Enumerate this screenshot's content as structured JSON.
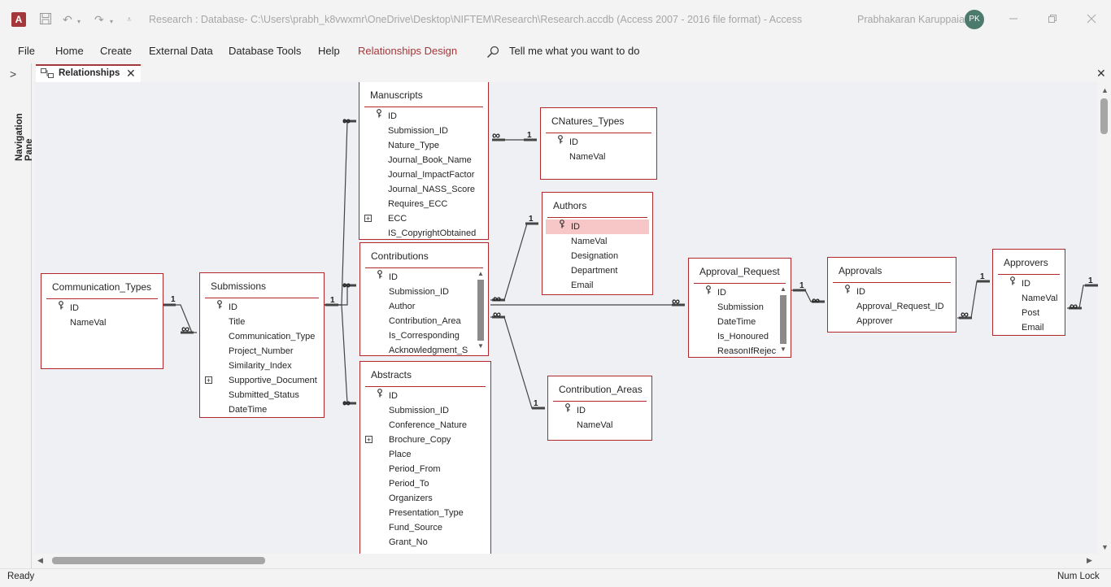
{
  "titlebar": {
    "app_letter": "A",
    "title": "Research : Database- C:\\Users\\prabh_k8vwxmr\\OneDrive\\Desktop\\NIFTEM\\Research\\Research.accdb (Access 2007 - 2016 file format)  -  Access",
    "user": "Prabhakaran Karuppaiah",
    "initials": "PK"
  },
  "menu": [
    "File",
    "Home",
    "Create",
    "External Data",
    "Database Tools",
    "Help",
    "Relationships Design"
  ],
  "search": {
    "text": "Tell me what you want to do"
  },
  "nav": {
    "label": "Navigation Pane"
  },
  "tab": {
    "label": "Relationships"
  },
  "tables": [
    {
      "id": "communication-types",
      "title": "Communication_Types",
      "fields": [
        "ID",
        "NameVal"
      ],
      "keys": [
        0
      ]
    },
    {
      "id": "submissions",
      "title": "Submissions",
      "fields": [
        "ID",
        "Title",
        "Communication_Type",
        "Project_Number",
        "Similarity_Index",
        "Supportive_Document",
        "Submitted_Status",
        "DateTime"
      ],
      "keys": [
        0
      ],
      "plus": [
        5
      ]
    },
    {
      "id": "manuscripts",
      "title": "Manuscripts",
      "fields": [
        "ID",
        "Submission_ID",
        "Nature_Type",
        "Journal_Book_Name",
        "Journal_ImpactFactor",
        "Journal_NASS_Score",
        "Requires_ECC",
        "ECC",
        "IS_CopyrightObtained"
      ],
      "keys": [
        0
      ],
      "plus": [
        7
      ]
    },
    {
      "id": "contributions",
      "title": "Contributions",
      "fields": [
        "ID",
        "Submission_ID",
        "Author",
        "Contribution_Area",
        "Is_Corresponding",
        "Acknowledgment_S"
      ],
      "keys": [
        0
      ]
    },
    {
      "id": "abstracts",
      "title": "Abstracts",
      "fields": [
        "ID",
        "Submission_ID",
        "Conference_Nature",
        "Brochure_Copy",
        "Place",
        "Period_From",
        "Period_To",
        "Organizers",
        "Presentation_Type",
        "Fund_Source",
        "Grant_No"
      ],
      "keys": [
        0
      ],
      "plus": [
        3
      ]
    },
    {
      "id": "cnatures-types",
      "title": "CNatures_Types",
      "fields": [
        "ID",
        "NameVal"
      ],
      "keys": [
        0
      ]
    },
    {
      "id": "authors",
      "title": "Authors",
      "fields": [
        "ID",
        "NameVal",
        "Designation",
        "Department",
        "Email"
      ],
      "keys": [
        0
      ],
      "selected": 0
    },
    {
      "id": "contribution-areas",
      "title": "Contribution_Areas",
      "fields": [
        "ID",
        "NameVal"
      ],
      "keys": [
        0
      ]
    },
    {
      "id": "approval-request",
      "title": "Approval_Request",
      "fields": [
        "ID",
        "Submission",
        "DateTime",
        "Is_Honoured",
        "ReasonIfRejec"
      ],
      "keys": [
        0
      ]
    },
    {
      "id": "approvals",
      "title": "Approvals",
      "fields": [
        "ID",
        "Approval_Request_ID",
        "Approver"
      ],
      "keys": [
        0
      ]
    },
    {
      "id": "approvers",
      "title": "Approvers",
      "fields": [
        "ID",
        "NameVal",
        "Post",
        "Email"
      ],
      "keys": [
        0
      ]
    }
  ],
  "rel_labels": {
    "one": "1",
    "many": "∞"
  },
  "status": {
    "left": "Ready",
    "right": "Num Lock"
  },
  "colors": {
    "accent": "#a4373a",
    "table_border": "#b2272c",
    "selected_row": "#f7c6c7",
    "canvas": "#eef0f3"
  }
}
